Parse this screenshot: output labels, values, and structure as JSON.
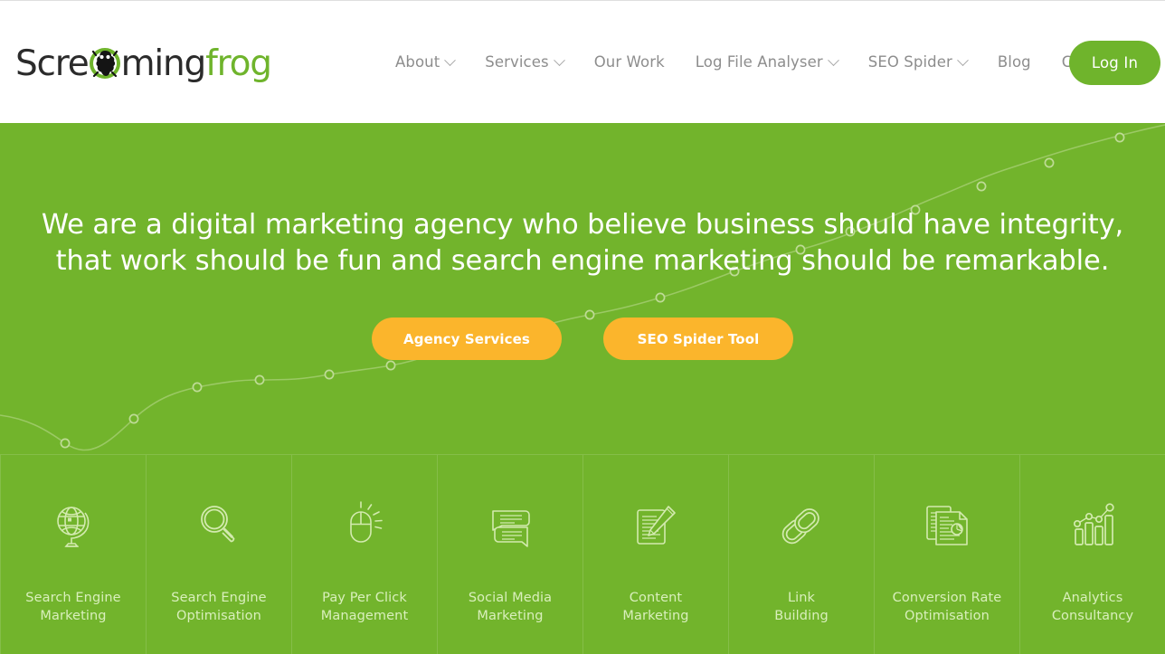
{
  "brand": {
    "logo_part1": "Scre",
    "logo_mark": "frog-globe-icon",
    "logo_part2": "ming",
    "logo_part3": "frog",
    "green": "#72b42c",
    "orange": "#fbb52c",
    "nav_text": "#8d8d8d"
  },
  "nav": {
    "items": [
      {
        "label": "About",
        "has_dropdown": true
      },
      {
        "label": "Services",
        "has_dropdown": true
      },
      {
        "label": "Our Work",
        "has_dropdown": false
      },
      {
        "label": "Log File Analyser",
        "has_dropdown": true
      },
      {
        "label": "SEO Spider",
        "has_dropdown": true
      },
      {
        "label": "Blog",
        "has_dropdown": false
      },
      {
        "label": "Contact",
        "has_dropdown": false
      }
    ],
    "login_label": "Log In"
  },
  "hero": {
    "line1": "We are a digital marketing agency who believe business should have integrity,",
    "line2": "that work should be fun and search engine marketing should be remarkable.",
    "cta_primary": "Agency Services",
    "cta_secondary": "SEO Spider Tool"
  },
  "tiles": [
    {
      "icon": "globe-icon",
      "label": "Search Engine\nMarketing"
    },
    {
      "icon": "magnifier-icon",
      "label": "Search Engine\nOptimisation"
    },
    {
      "icon": "mouse-click-icon",
      "label": "Pay Per Click\nManagement"
    },
    {
      "icon": "chat-bubbles-icon",
      "label": "Social Media\nMarketing"
    },
    {
      "icon": "document-pencil-icon",
      "label": "Content\nMarketing"
    },
    {
      "icon": "chain-links-icon",
      "label": "Link\nBuilding"
    },
    {
      "icon": "documents-chart-icon",
      "label": "Conversion Rate\nOptimisation"
    },
    {
      "icon": "bar-chart-trend-icon",
      "label": "Analytics\nConsultancy"
    }
  ]
}
